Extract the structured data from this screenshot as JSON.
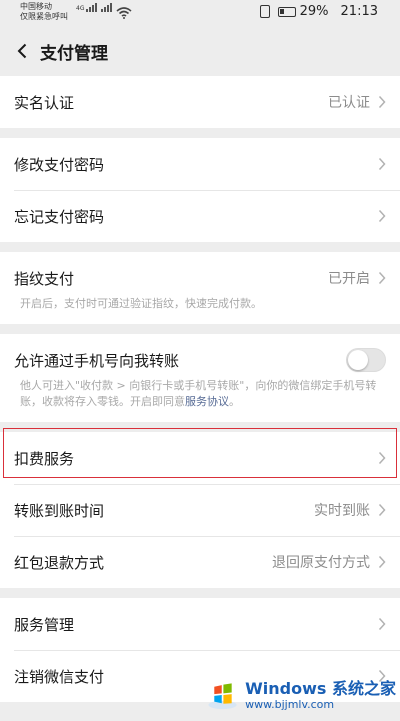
{
  "status_bar": {
    "carrier_line1": "中国移动",
    "carrier_line2": "仅限紧急呼叫",
    "network": "4G",
    "battery": "29%",
    "time": "21:13"
  },
  "nav": {
    "title": "支付管理"
  },
  "groups": {
    "realname": {
      "label": "实名认证",
      "value": "已认证"
    },
    "change_pwd": {
      "label": "修改支付密码"
    },
    "forgot_pwd": {
      "label": "忘记支付密码"
    },
    "fingerprint": {
      "label": "指纹支付",
      "value": "已开启",
      "desc": "开启后，支付时可通过验证指纹，快速完成付款。"
    },
    "phone_transfer": {
      "label": "允许通过手机号向我转账",
      "enabled": false,
      "desc": "他人可进入\"收付款 > 向银行卡或手机号转账\"，向你的微信绑定手机号转账，收款将存入零钱。开启即同意",
      "link": "服务协议",
      "desc_end": "。"
    },
    "deduction": {
      "label": "扣费服务"
    },
    "arrival_time": {
      "label": "转账到账时间",
      "value": "实时到账"
    },
    "refund": {
      "label": "红包退款方式",
      "value": "退回原支付方式"
    },
    "service_mgmt": {
      "label": "服务管理"
    },
    "cancel_pay": {
      "label": "注销微信支付"
    }
  },
  "watermark": {
    "brand": "Windows",
    "brand_cn": "系统之家",
    "url": "www.bjjmlv.com"
  },
  "colors": {
    "highlight": "#d9303a",
    "link": "#576b95",
    "background": "#ededed"
  }
}
